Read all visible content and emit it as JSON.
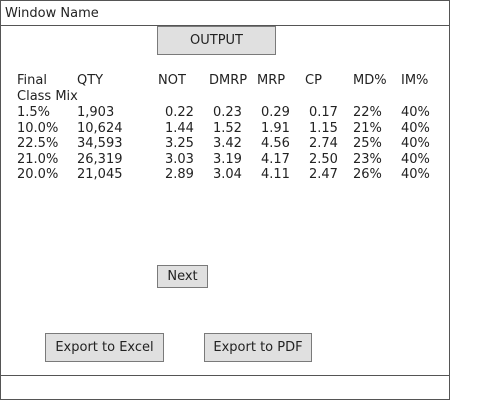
{
  "window": {
    "title": "Window Name"
  },
  "buttons": {
    "output": "OUTPUT",
    "next": "Next",
    "export_excel": "Export to Excel",
    "export_pdf": "Export to PDF"
  },
  "table": {
    "headers": [
      "Final",
      "QTY",
      "NOT",
      "DMRP",
      "MRP",
      "CP",
      "MD%",
      "IM%"
    ],
    "header_line2": "Class Mix",
    "rows": [
      [
        "1.5%",
        "1,903",
        "0.22",
        "0.23",
        "0.29",
        "0.17",
        "22%",
        "40%"
      ],
      [
        "10.0%",
        "10,624",
        "1.44",
        "1.52",
        "1.91",
        "1.15",
        "21%",
        "40%"
      ],
      [
        "22.5%",
        "34,593",
        "3.25",
        "3.42",
        "4.56",
        "2.74",
        "25%",
        "40%"
      ],
      [
        "21.0%",
        "26,319",
        "3.03",
        "3.19",
        "4.17",
        "2.50",
        "23%",
        "40%"
      ],
      [
        "20.0%",
        "21,045",
        "2.89",
        "3.04",
        "4.11",
        "2.47",
        "26%",
        "40%"
      ]
    ]
  }
}
